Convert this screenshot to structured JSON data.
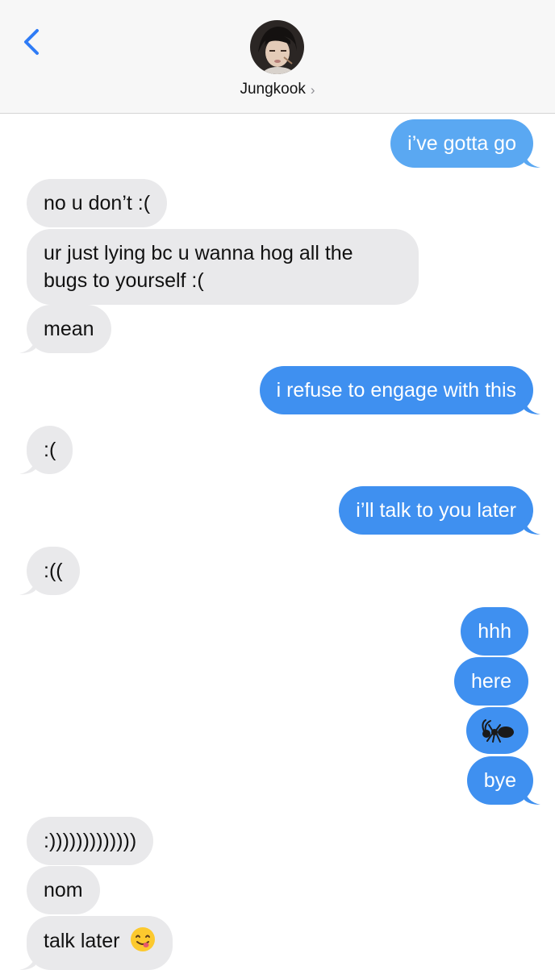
{
  "header": {
    "contact_name": "Jungkook",
    "chevron": "›"
  },
  "messages": [
    {
      "dir": "out",
      "text": "i’ve gotta go"
    },
    {
      "dir": "in",
      "text": "no u don’t :("
    },
    {
      "dir": "in",
      "text": "ur just lying bc u wanna hog all the bugs to yourself :("
    },
    {
      "dir": "in",
      "text": "mean"
    },
    {
      "dir": "out",
      "text": "i refuse to engage with this"
    },
    {
      "dir": "in",
      "text": ":("
    },
    {
      "dir": "out",
      "text": "i’ll talk to you later"
    },
    {
      "dir": "in",
      "text": ":(("
    },
    {
      "dir": "out",
      "text": "hhh"
    },
    {
      "dir": "out",
      "text": "here"
    },
    {
      "dir": "out",
      "icon": "ant-emoji"
    },
    {
      "dir": "out",
      "text": "bye"
    },
    {
      "dir": "in",
      "text": ":)))))))))))))"
    },
    {
      "dir": "in",
      "text": "nom"
    },
    {
      "dir": "in",
      "text": "talk later",
      "icon": "yum-face-emoji"
    }
  ],
  "colors": {
    "outgoing_bubble": "#5aa8f2",
    "outgoing_bubble_dark": "#3f90f0",
    "incoming_bubble": "#e9e9eb",
    "accent": "#2f7cf6"
  }
}
